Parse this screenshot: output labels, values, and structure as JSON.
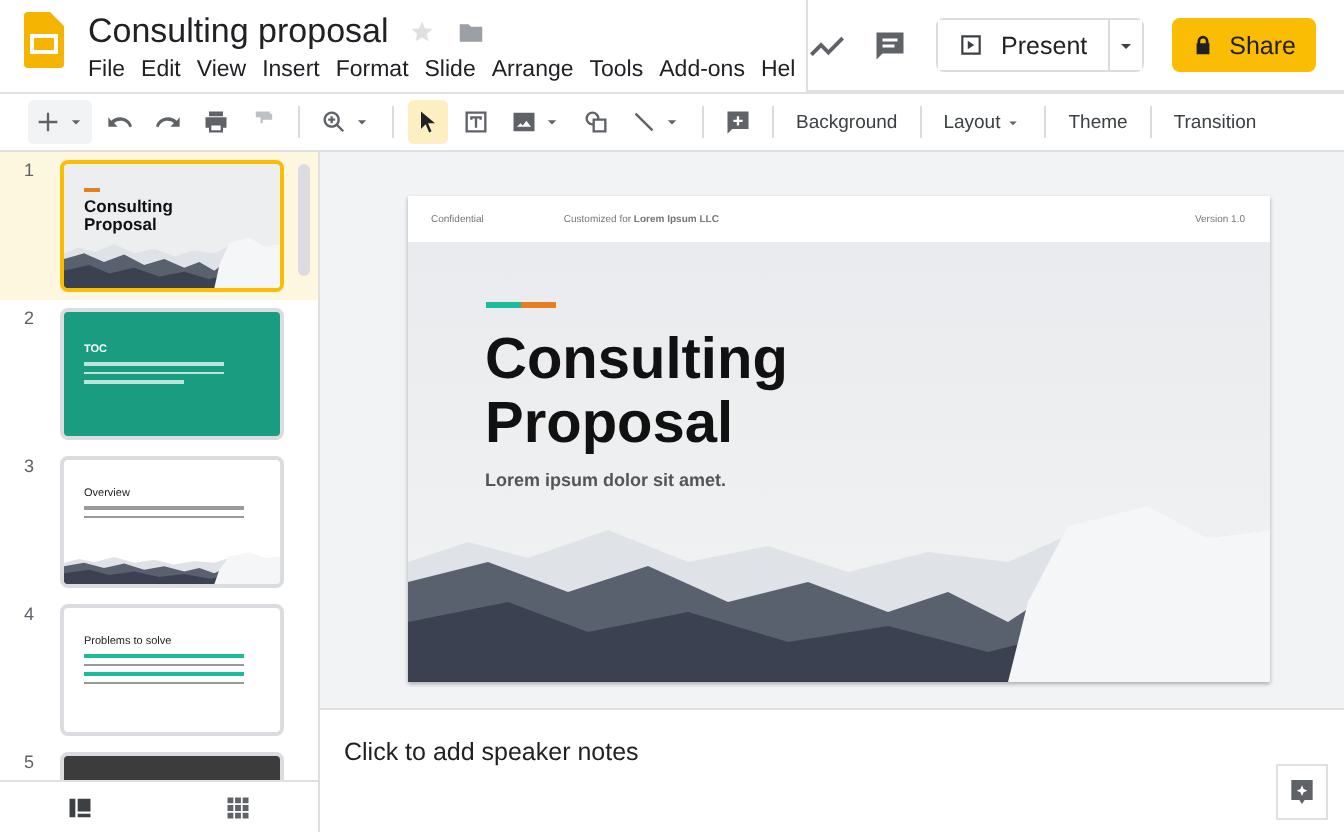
{
  "app": {
    "title": "Consulting proposal"
  },
  "menu": [
    "File",
    "Edit",
    "View",
    "Insert",
    "Format",
    "Slide",
    "Arrange",
    "Tools",
    "Add-ons",
    "Hel"
  ],
  "actions": {
    "present": "Present",
    "share": "Share"
  },
  "toolbar": {
    "pointer_selected": true,
    "buttons": [
      {
        "label": "Background",
        "dropdown": false
      },
      {
        "label": "Layout",
        "dropdown": true
      },
      {
        "label": "Theme",
        "dropdown": false
      },
      {
        "label": "Transition",
        "dropdown": false
      }
    ]
  },
  "slides": [
    {
      "number": "1",
      "selected": true,
      "kind": "title",
      "title": "Consulting Proposal"
    },
    {
      "number": "2",
      "selected": false,
      "kind": "toc",
      "title": "TOC"
    },
    {
      "number": "3",
      "selected": false,
      "kind": "overview",
      "title": "Overview"
    },
    {
      "number": "4",
      "selected": false,
      "kind": "bullets",
      "title": "Problems to solve"
    },
    {
      "number": "5",
      "selected": false,
      "kind": "dark"
    }
  ],
  "slide": {
    "header_left": "Confidential",
    "header_middle": "Customized for **Lorem Ipsum LLC**",
    "header_right": "Version 1.0",
    "title": "Consulting Proposal",
    "subtitle": "Lorem ipsum dolor sit amet."
  },
  "notes": {
    "placeholder": "Click to add speaker notes"
  }
}
